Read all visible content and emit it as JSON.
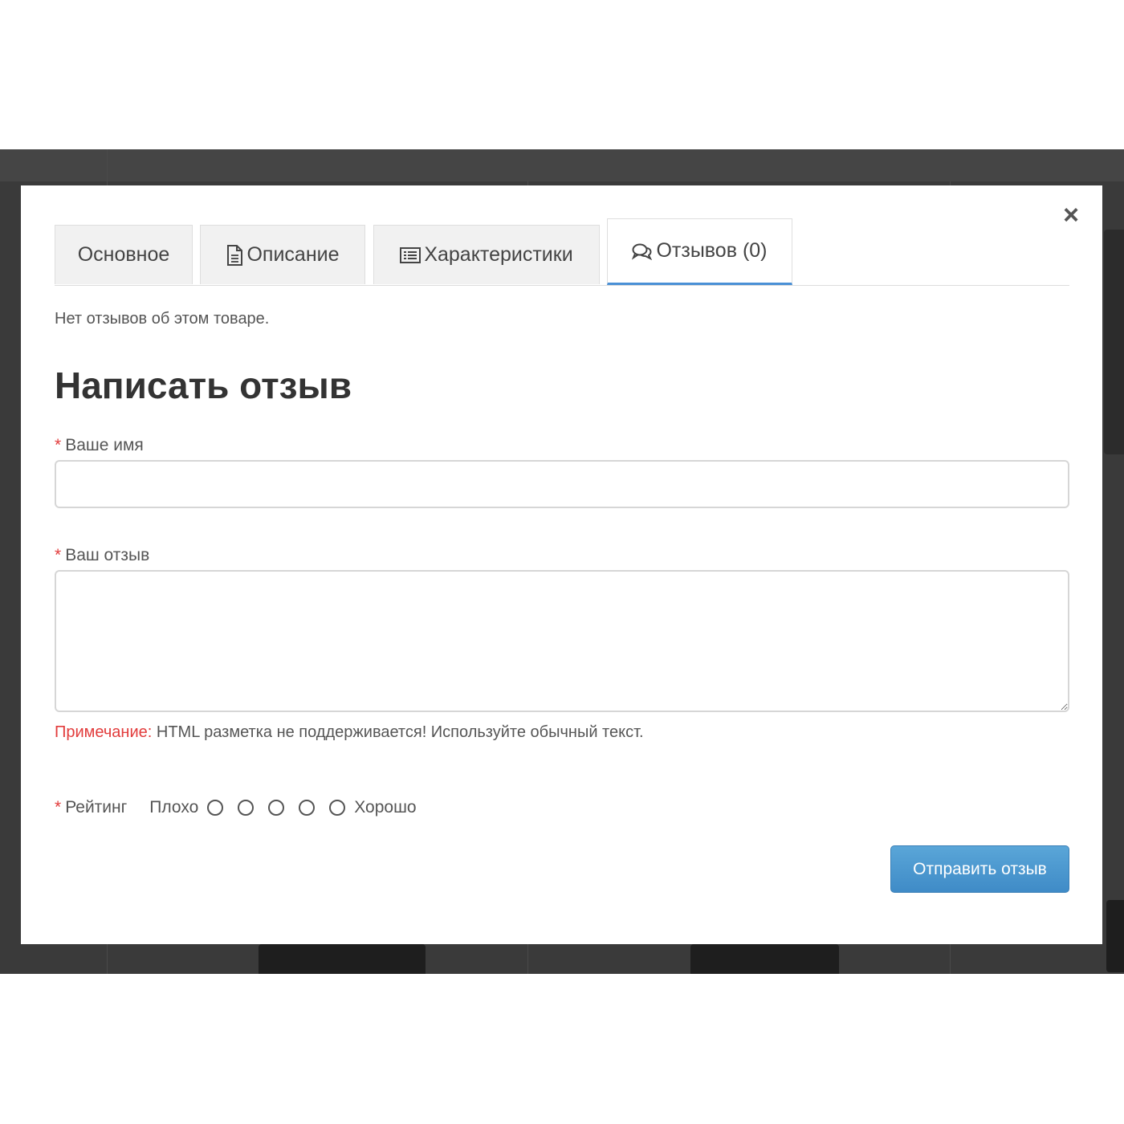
{
  "modal": {
    "close_glyph": "×",
    "tabs": [
      {
        "label": "Основное",
        "icon": "",
        "active": false
      },
      {
        "label": "Описание",
        "icon": "document-icon",
        "active": false
      },
      {
        "label": "Характеристики",
        "icon": "list-icon",
        "active": false
      },
      {
        "label": "Отзывов (0)",
        "icon": "comments-icon",
        "active": true
      }
    ],
    "empty_text": "Нет отзывов об этом товаре.",
    "heading": "Написать отзыв",
    "form": {
      "required_mark": "*",
      "name_label": "Ваше имя",
      "name_value": "",
      "review_label": "Ваш отзыв",
      "review_value": "",
      "note_label": "Примечание:",
      "note_text": " HTML разметка не поддерживается! Используйте обычный текст.",
      "rating_label": "Рейтинг",
      "rating_low": "Плохо",
      "rating_high": "Хорошо",
      "rating_options": [
        "1",
        "2",
        "3",
        "4",
        "5"
      ],
      "submit_label": "Отправить отзыв"
    },
    "colors": {
      "accent": "#4a90d6",
      "required": "#e23c3c",
      "button": "#4a97cf",
      "overlay": "#3a3a3a"
    }
  }
}
